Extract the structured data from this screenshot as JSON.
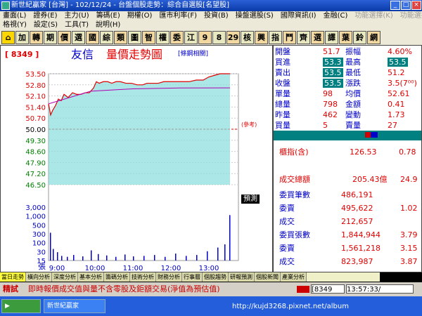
{
  "window": {
    "title": "新世紀贏家 [台灣] - 102/12/24 - 台盤個股走勢：綜合自選股[名望股]"
  },
  "menu": {
    "row1": [
      "畫面(L)",
      "證券(E)",
      "主力(U)",
      "籌碼(E)",
      "期權(O)",
      "匯市利率(F)",
      "投資(B)",
      "操盤選股(S)",
      "國際資訊(I)",
      "金融(C)",
      "功能選擇(K)",
      "功能選擇(K)"
    ],
    "row2": [
      "格視(Y)",
      "設定(S)",
      "工具(T)",
      "說明(H)"
    ]
  },
  "toolbar": [
    "加",
    "轉",
    "期",
    "價",
    "選",
    "國",
    "綜",
    "類",
    "圖",
    "智",
    "權",
    "委",
    "江",
    "9",
    "8",
    "29",
    "核",
    "興",
    "指",
    "鬥",
    "齊",
    "選",
    "譯",
    "葉",
    "鈴",
    "網"
  ],
  "stock": {
    "code": "[ 8349 ]",
    "name": "友信",
    "chart_title": "量價走勢圖",
    "related": "[條鋼相關]"
  },
  "chart_extra": {
    "ref_label": "(參考)",
    "forecast": "預測",
    "vol_label": "張"
  },
  "quote": [
    {
      "label": "開盤",
      "value": "51.7",
      "label2": "振幅",
      "value2": "4.60%"
    },
    {
      "label": "買進",
      "value": "53.3",
      "label2": "最高",
      "value2": "53.5"
    },
    {
      "label": "賣出",
      "value": "53.5",
      "label2": "最低",
      "value2": "51.2"
    },
    {
      "label": "收盤",
      "value": "53.5",
      "label2": "漲跌",
      "value2": "3.5(7⁰⁰)"
    },
    {
      "label": "單量",
      "value": "98",
      "label2": "均價",
      "value2": "52.61"
    },
    {
      "label": "總量",
      "value": "798",
      "label2": "金額",
      "value2": "0.41"
    },
    {
      "label": "昨量",
      "value": "462",
      "label2": "變動",
      "value2": "1.73"
    },
    {
      "label": "買量",
      "value": "5",
      "label2": "賣量",
      "value2": "27"
    }
  ],
  "index": {
    "label": "櫃指(含)",
    "value": "126.53",
    "change": "0.78"
  },
  "turnover": {
    "label": "成交總額",
    "value": "205.43億",
    "change": "24.9"
  },
  "orders": [
    {
      "label": "委買筆數",
      "value": "486,191",
      "pct": ""
    },
    {
      "label": "委賣",
      "value": "495,622",
      "pct": "1.02"
    },
    {
      "label": "成交",
      "value": "212,657",
      "pct": ""
    },
    {
      "label": "委買張數",
      "value": "1,844,944",
      "pct": "3.79"
    },
    {
      "label": "委賣",
      "value": "1,561,218",
      "pct": "3.15"
    },
    {
      "label": "成交",
      "value": "823,987",
      "pct": "3.87"
    }
  ],
  "tabs": [
    "當日走勢",
    "橫向分析",
    "深度分析",
    "基本分析",
    "籌碼分析",
    "技術分析",
    "財務分析",
    "行事曆",
    "個股趨勢",
    "研報預測",
    "個股新聞",
    "產業分析"
  ],
  "status": {
    "mode": "精試",
    "message": "即時報價成交值與量不含零股及鉅額交易(淨值為預估值)",
    "code": "[8349",
    "time": "13:57:33/"
  },
  "taskbar": {
    "windows": [
      "新世紀贏家",
      "http://kujd3268.pixnet.net/album"
    ]
  },
  "watermark": "http://kujd3268.pixnet.net/album",
  "colors": {
    "price_line": "#e00000",
    "volume_bar": "#0000c8",
    "area": "#88dddd",
    "avg_line": "#b000b0"
  },
  "chart_data": {
    "type": "line",
    "title": "量價走勢圖",
    "x_ticks": [
      "9:00",
      "10:00",
      "11:00",
      "12:00",
      "13:00"
    ],
    "y_ticks": [
      "53.50",
      "52.80",
      "52.10",
      "51.40",
      "50.70",
      "50.00",
      "49.30",
      "48.60",
      "47.90",
      "47.20",
      "46.50"
    ],
    "ylim": [
      46.5,
      53.5
    ],
    "ref_price": 50.0,
    "price": [
      [
        0,
        51.6
      ],
      [
        3,
        50.9
      ],
      [
        6,
        51.2
      ],
      [
        10,
        51.5
      ],
      [
        14,
        51.9
      ],
      [
        18,
        51.8
      ],
      [
        22,
        52.2
      ],
      [
        28,
        52.0
      ],
      [
        34,
        52.3
      ],
      [
        40,
        52.2
      ],
      [
        46,
        52.2
      ],
      [
        52,
        52.3
      ],
      [
        58,
        52.3
      ],
      [
        64,
        52.6
      ],
      [
        68,
        53.0
      ],
      [
        72,
        52.9
      ],
      [
        78,
        53.0
      ],
      [
        84,
        53.0
      ],
      [
        90,
        52.9
      ],
      [
        96,
        53.0
      ],
      [
        102,
        53.0
      ],
      [
        110,
        52.9
      ],
      [
        118,
        52.9
      ],
      [
        126,
        52.8
      ],
      [
        134,
        52.8
      ],
      [
        140,
        52.9
      ],
      [
        148,
        52.9
      ],
      [
        156,
        52.9
      ],
      [
        164,
        53.0
      ],
      [
        172,
        53.0
      ],
      [
        180,
        53.0
      ],
      [
        190,
        53.0
      ],
      [
        200,
        53.0
      ],
      [
        210,
        53.1
      ],
      [
        220,
        53.1
      ],
      [
        228,
        53.3
      ],
      [
        236,
        53.4
      ],
      [
        244,
        53.5
      ],
      [
        252,
        53.5
      ],
      [
        258,
        53.5
      ]
    ],
    "avg": [
      [
        0,
        51.6
      ],
      [
        60,
        52.4
      ],
      [
        120,
        52.55
      ],
      [
        180,
        52.6
      ],
      [
        258,
        52.61
      ]
    ],
    "volume_axis": [
      "3,000",
      "1,000",
      "500",
      "300",
      "100",
      "30",
      "15"
    ],
    "volume": [
      [
        2,
        60
      ],
      [
        6,
        25
      ],
      [
        12,
        18
      ],
      [
        18,
        10
      ],
      [
        26,
        8
      ],
      [
        35,
        12
      ],
      [
        48,
        9
      ],
      [
        60,
        22
      ],
      [
        70,
        14
      ],
      [
        82,
        11
      ],
      [
        95,
        8
      ],
      [
        108,
        13
      ],
      [
        120,
        9
      ],
      [
        135,
        10
      ],
      [
        150,
        12
      ],
      [
        165,
        8
      ],
      [
        180,
        15
      ],
      [
        195,
        10
      ],
      [
        210,
        12
      ],
      [
        225,
        20
      ],
      [
        240,
        28
      ],
      [
        250,
        35
      ],
      [
        257,
        98
      ]
    ]
  }
}
